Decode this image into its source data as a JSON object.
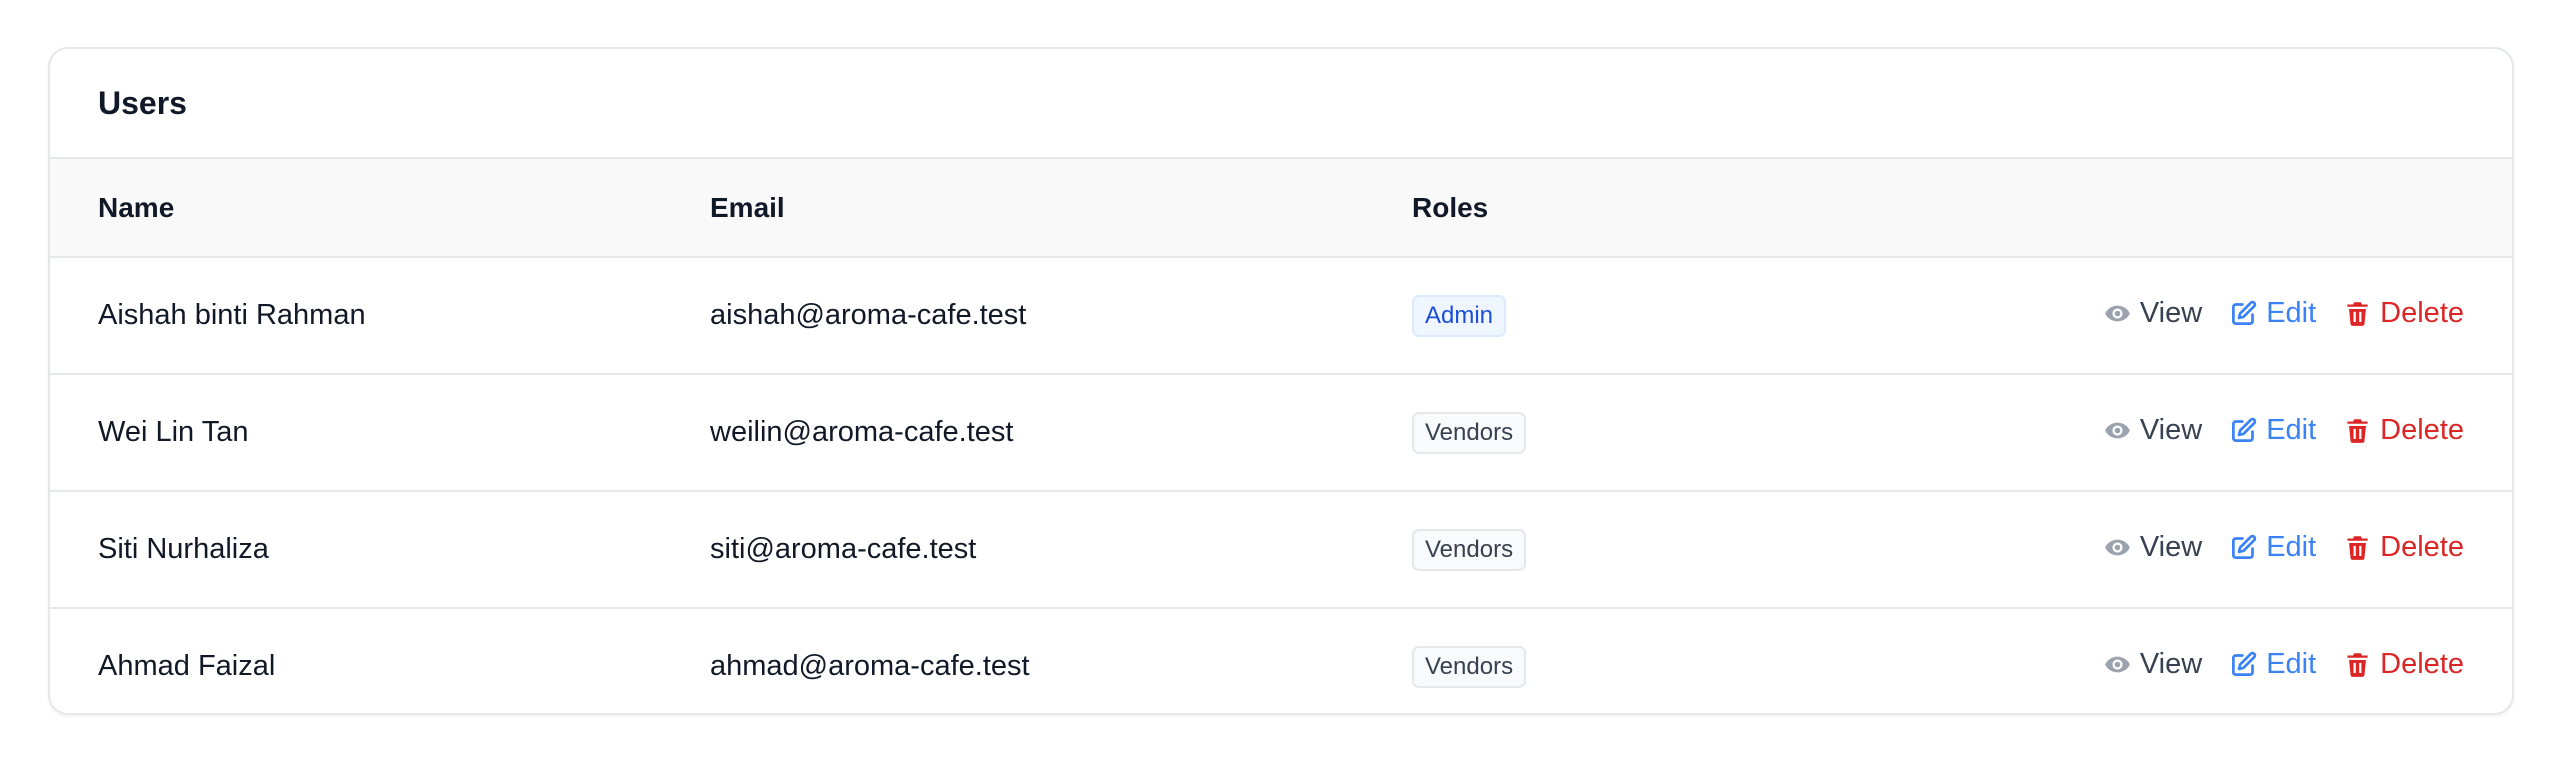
{
  "panel": {
    "title": "Users"
  },
  "table": {
    "columns": {
      "name": "Name",
      "email": "Email",
      "roles": "Roles"
    },
    "rows": [
      {
        "name": "Aishah binti Rahman",
        "email": "aishah@aroma-cafe.test",
        "role": "Admin"
      },
      {
        "name": "Wei Lin Tan",
        "email": "weilin@aroma-cafe.test",
        "role": "Vendors"
      },
      {
        "name": "Siti Nurhaliza",
        "email": "siti@aroma-cafe.test",
        "role": "Vendors"
      },
      {
        "name": "Ahmad Faizal",
        "email": "ahmad@aroma-cafe.test",
        "role": "Vendors"
      }
    ]
  },
  "actions": {
    "view": "View",
    "edit": "Edit",
    "delete": "Delete"
  },
  "icons": {
    "view": "eye-icon",
    "edit": "edit-icon",
    "delete": "trash-icon"
  },
  "colors": {
    "edit": "#3b82f6",
    "delete": "#dc2626",
    "admin_badge": "#1d4ed8",
    "vendor_badge": "#374151"
  }
}
